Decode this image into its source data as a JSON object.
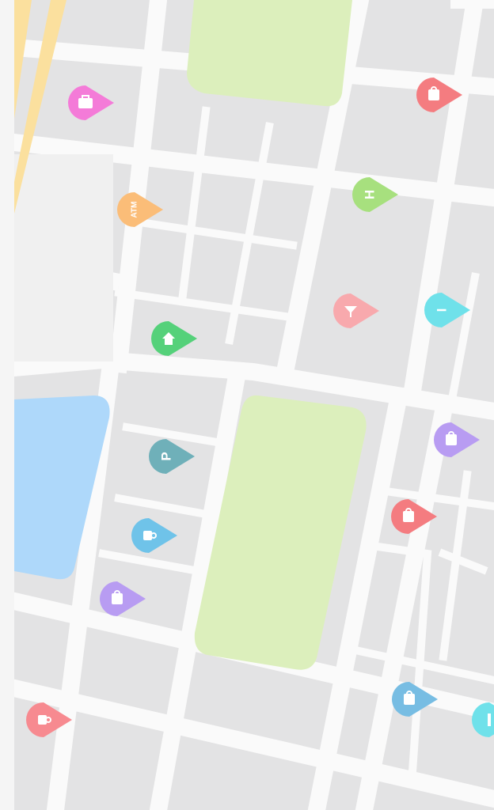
{
  "map": {
    "colors": {
      "background": "#f3f3f3",
      "left_strip": "#f5f5f5",
      "block": "#e3e3e4",
      "road": "#fafafa",
      "park": "#dcefbc",
      "water": "#aed8fa",
      "highway": "#fbe09e"
    },
    "pins": [
      {
        "name": "shopping-bag-pin",
        "icon": "briefcase-icon",
        "color": "#f47bd8",
        "label": ""
      },
      {
        "name": "shopping-bag-pin",
        "icon": "shopping-bag-icon",
        "color": "#f47c80",
        "label": ""
      },
      {
        "name": "atm-pin",
        "icon": "atm-text-icon",
        "color": "#fbbd78",
        "label": "ATM"
      },
      {
        "name": "hospital-pin",
        "icon": "hospital-icon",
        "color": "#a7e07e",
        "label": "H"
      },
      {
        "name": "bar-pin",
        "icon": "cocktail-icon",
        "color": "#f8a9ad",
        "label": ""
      },
      {
        "name": "info-pin",
        "icon": "info-icon",
        "color": "#6fe1ea",
        "label": "I"
      },
      {
        "name": "home-pin",
        "icon": "home-icon",
        "color": "#55d17a",
        "label": ""
      },
      {
        "name": "parking-pin",
        "icon": "parking-icon",
        "color": "#6fb0b9",
        "label": "P"
      },
      {
        "name": "shopping-pin",
        "icon": "shopping-bag-icon",
        "color": "#b89cf2",
        "label": ""
      },
      {
        "name": "cafe-pin",
        "icon": "coffee-cup-icon",
        "color": "#6fc3e9",
        "label": ""
      },
      {
        "name": "shopping-bag-pin",
        "icon": "shopping-bag-icon",
        "color": "#f47c80",
        "label": ""
      },
      {
        "name": "shopping-pin",
        "icon": "shopping-bag-icon",
        "color": "#b89cf2",
        "label": ""
      },
      {
        "name": "coffee-pin",
        "icon": "coffee-cup-icon",
        "color": "#f78a90",
        "label": ""
      },
      {
        "name": "bag-pin",
        "icon": "shopping-bag-icon",
        "color": "#77bde3",
        "label": ""
      },
      {
        "name": "info-pin",
        "icon": "info-icon",
        "color": "#6fe1ea",
        "label": ""
      }
    ]
  }
}
